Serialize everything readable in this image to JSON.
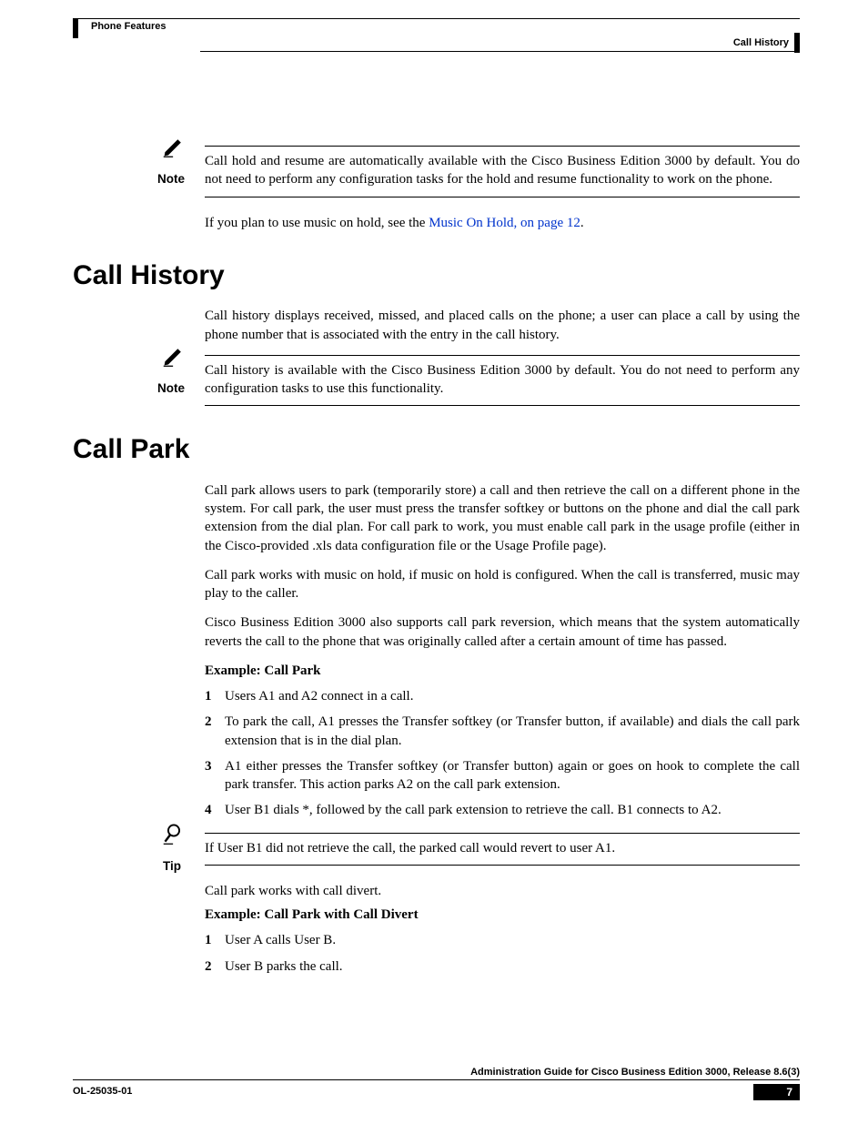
{
  "header": {
    "left": "Phone Features",
    "right": "Call History"
  },
  "note1": {
    "label": "Note",
    "text": "Call hold and resume are automatically available with the Cisco Business Edition 3000 by default. You do not need to perform any configuration tasks for the hold and resume functionality to work on the phone."
  },
  "para_moh_pre": "If you plan to use music on hold, see the ",
  "para_moh_link": "Music On Hold,  on page 12",
  "para_moh_post": ".",
  "section1": {
    "title": "Call History",
    "intro": "Call history displays received, missed, and placed calls on the phone; a user can place a call by using the phone number that is associated with the entry in the call history."
  },
  "note2": {
    "label": "Note",
    "text": "Call history is available with the Cisco Business Edition 3000 by default. You do not need to perform any configuration tasks to use this functionality."
  },
  "section2": {
    "title": "Call Park",
    "p1": "Call park allows users to park (temporarily store) a call and then retrieve the call on a different phone in the system. For call park, the user must press the transfer softkey or buttons on the phone and dial the call park extension from the dial plan. For call park to work, you must enable call park in the usage profile (either in the Cisco-provided .xls data configuration file or the Usage Profile page).",
    "p2": "Call park works with music on hold, if music on hold is configured. When the call is transferred, music may play to the caller.",
    "p3": "Cisco Business Edition 3000 also supports call park reversion, which means that the system automatically reverts the call to the phone that was originally called after a certain amount of time has passed.",
    "example1_h": "Example: Call Park",
    "steps1": [
      "Users A1 and A2 connect in a call.",
      "To park the call, A1 presses the Transfer softkey (or Transfer button, if available) and dials the call park extension that is in the dial plan.",
      "A1 either presses the Transfer softkey (or Transfer button) again or goes on hook to complete the call park transfer. This action parks A2 on the call park extension.",
      "User B1 dials *, followed by the call park extension to retrieve the call. B1 connects to A2."
    ]
  },
  "tip": {
    "label": "Tip",
    "text": "If User B1 did not retrieve the call, the parked call would revert to user A1."
  },
  "after_tip": "Call park works with call divert.",
  "example2_h": "Example: Call Park with Call Divert",
  "steps2": [
    "User A calls User B.",
    "User B parks the call."
  ],
  "footer": {
    "title": "Administration Guide for Cisco Business Edition 3000, Release 8.6(3)",
    "doc": "OL-25035-01",
    "page": "7"
  }
}
